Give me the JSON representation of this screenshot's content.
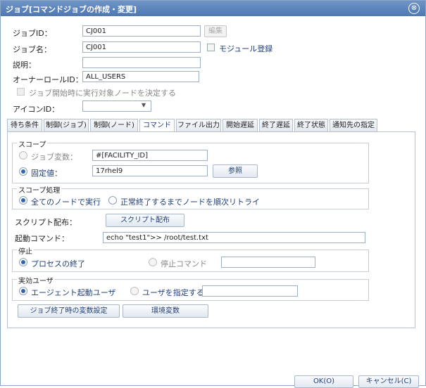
{
  "window": {
    "title": "ジョブ[コマンドジョブの作成・変更]",
    "close_glyph": "⊗"
  },
  "form": {
    "job_id_label": "ジョブID：",
    "job_id_value": "CJ001",
    "edit_button": "編集",
    "job_name_label": "ジョブ名：",
    "job_name_value": "CJ001",
    "module_register_label": "モジュール登録",
    "description_label": "説明：",
    "description_value": "",
    "owner_role_label": "オーナーロールID：",
    "owner_role_value": "ALL_USERS",
    "decide_node_label": "ジョブ開始時に実行対象ノードを決定する",
    "icon_id_label": "アイコンID：",
    "icon_id_value": ""
  },
  "tabs": [
    {
      "label": "待ち条件"
    },
    {
      "label": "制御(ジョブ)"
    },
    {
      "label": "制御(ノード)"
    },
    {
      "label": "コマンド"
    },
    {
      "label": "ファイル出力"
    },
    {
      "label": "開始遅延"
    },
    {
      "label": "終了遅延"
    },
    {
      "label": "終了状態"
    },
    {
      "label": "通知先の指定"
    }
  ],
  "command_tab": {
    "scope": {
      "legend": "スコープ",
      "job_variable_label": "ジョブ変数：",
      "job_variable_value": "#[FACILITY_ID]",
      "fixed_value_label": "固定値：",
      "fixed_value_value": "17rhel9",
      "reference_button": "参照"
    },
    "scope_process": {
      "legend": "スコープ処理",
      "all_nodes_label": "全てのノードで実行",
      "retry_label": "正常終了するまでノードを順次リトライ"
    },
    "script_dist_label": "スクリプト配布：",
    "script_dist_button": "スクリプト配布",
    "start_command_label": "起動コマンド：",
    "start_command_value": "echo \"test1\">> /root/test.txt",
    "stop": {
      "legend": "停止",
      "process_end_label": "プロセスの終了",
      "stop_command_label": "停止コマンド",
      "stop_command_value": ""
    },
    "effective_user": {
      "legend": "実効ユーザ",
      "agent_user_label": "エージェント起動ユーザ",
      "specify_user_label": "ユーザを指定する",
      "specify_user_value": ""
    },
    "job_end_var_button": "ジョブ終了時の変数設定",
    "env_var_button": "環境変数"
  },
  "footer": {
    "ok_button": "OK(O)",
    "cancel_button": "キャンセル(C)"
  }
}
